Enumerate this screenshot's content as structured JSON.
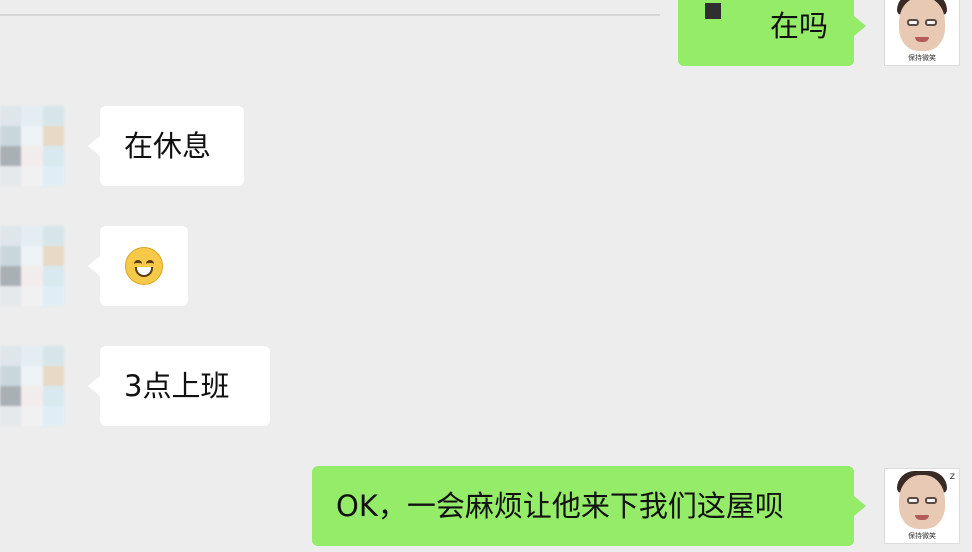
{
  "chat": {
    "messages": [
      {
        "side": "out",
        "text": "在吗"
      },
      {
        "side": "in",
        "text": "在休息"
      },
      {
        "side": "in",
        "emoji": "grinning-face"
      },
      {
        "side": "in",
        "text": "3点上班"
      },
      {
        "side": "out",
        "text": "OK，一会麻烦让他来下我们这屋呗"
      }
    ],
    "my_avatar_caption": "保持微笑"
  },
  "colors": {
    "background": "#ededed",
    "incoming_bubble": "#ffffff",
    "outgoing_bubble": "#95ec69"
  }
}
